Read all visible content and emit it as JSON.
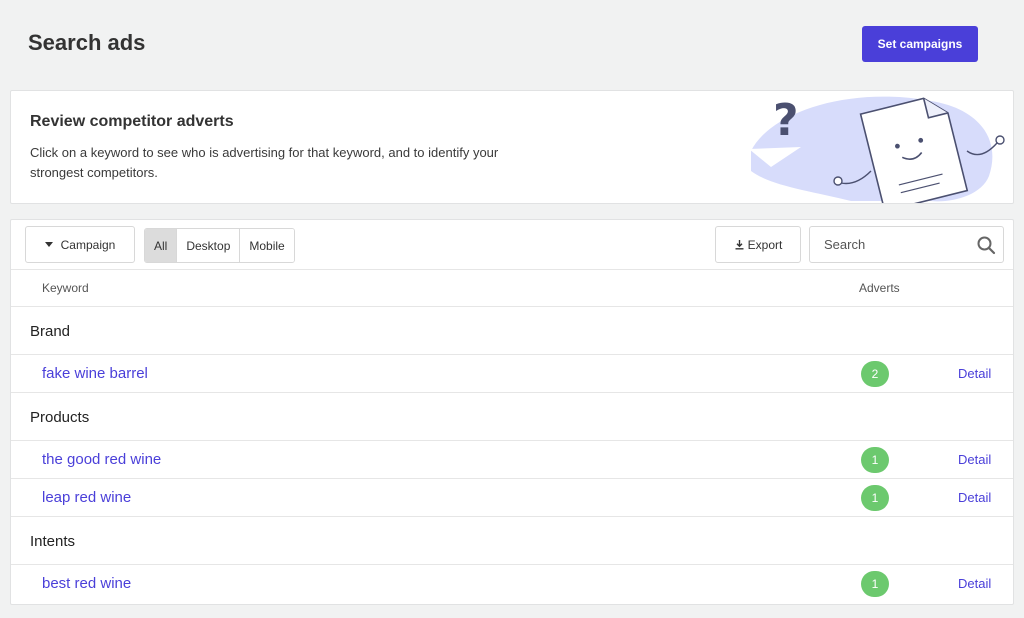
{
  "header": {
    "title": "Search ads",
    "set_campaigns_label": "Set campaigns"
  },
  "banner": {
    "title": "Review competitor adverts",
    "text": "Click on a keyword to see who is advertising for that keyword, and to identify your strongest competitors."
  },
  "toolbar": {
    "campaign_label": "Campaign",
    "device_filters": [
      "All",
      "Desktop",
      "Mobile"
    ],
    "active_filter": "All",
    "export_label": "Export",
    "search_placeholder": "Search"
  },
  "table": {
    "columns": {
      "keyword": "Keyword",
      "adverts": "Adverts"
    },
    "detail_label": "Detail",
    "groups": [
      {
        "name": "Brand",
        "keywords": [
          {
            "keyword": "fake wine barrel",
            "adverts": "2"
          }
        ]
      },
      {
        "name": "Products",
        "keywords": [
          {
            "keyword": "the good red wine",
            "adverts": "1"
          },
          {
            "keyword": "leap red wine",
            "adverts": "1"
          }
        ]
      },
      {
        "name": "Intents",
        "keywords": [
          {
            "keyword": "best red wine",
            "adverts": "1"
          }
        ]
      }
    ]
  },
  "colors": {
    "accent": "#4a3fd9",
    "badge": "#6cc96e",
    "illustration_blob": "#d7dcfb"
  },
  "icons": {
    "campaign_caret": "caret-down-icon",
    "export": "download-icon",
    "search": "search-icon"
  }
}
